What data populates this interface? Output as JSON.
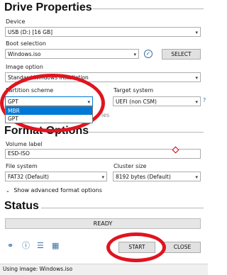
{
  "drive_properties": {
    "title": "Drive Properties",
    "device_label": "Device",
    "device_value": "USB (D:) [16 GB]",
    "boot_selection_label": "Boot selection",
    "boot_selection_value": "Windows.iso",
    "select_button": "SELECT",
    "image_option_label": "Image option",
    "image_option_value": "Standard Windows installation",
    "partition_scheme_label": "Partition scheme",
    "partition_scheme_value": "GPT",
    "partition_scheme_options": [
      "MBR",
      "GPT"
    ],
    "target_system_label": "Target system",
    "target_system_value": "UEFI (non CSM)",
    "help_glyph": "?",
    "hidden_text": "ies"
  },
  "format_options": {
    "title": "Format Options",
    "volume_label_label": "Volume label",
    "volume_label_value": "ESD-ISO",
    "file_system_label": "File system",
    "file_system_value": "FAT32 (Default)",
    "cluster_size_label": "Cluster size",
    "cluster_size_value": "8192 bytes (Default)",
    "advanced_toggle": "Show advanced format options"
  },
  "status": {
    "title": "Status",
    "progress_text": "READY",
    "start_button": "START",
    "close_button": "CLOSE"
  },
  "statusbar": {
    "text": "Using image: Windows.iso"
  },
  "colors": {
    "highlight": "#0078d7",
    "annotation_red": "#e0141f",
    "icon_blue": "#3a6ea5"
  },
  "icons": [
    "globe-icon",
    "info-icon",
    "settings-icon",
    "log-icon",
    "check-icon"
  ]
}
